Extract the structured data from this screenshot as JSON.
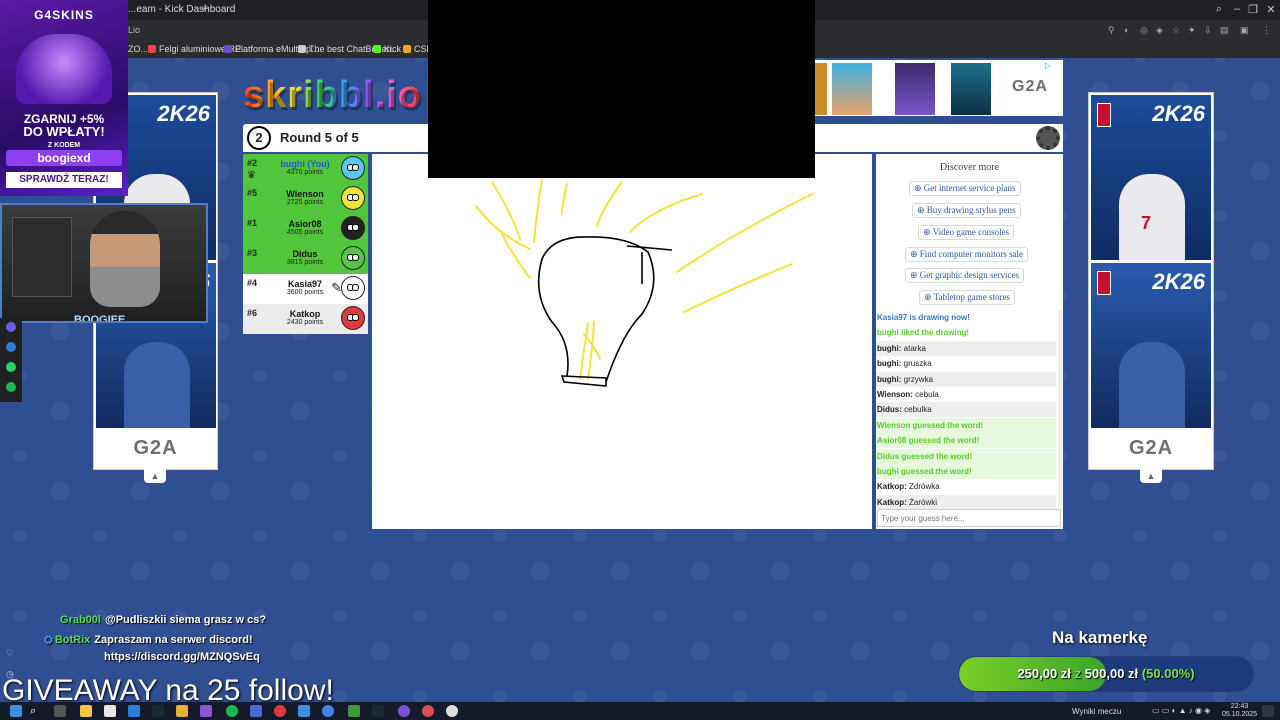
{
  "browser": {
    "tab_title": "...eam - Kick Dashboard",
    "new_tab": "+",
    "address_text": "Lio",
    "window_controls": [
      "–",
      "❐",
      "✕"
    ],
    "bookmarks": [
      {
        "label": "ZO...",
        "color": "#888"
      },
      {
        "label": "Felgi aluminiowe RE...",
        "color": "#e44"
      },
      {
        "label": "Platforma eMultiSp...",
        "color": "#6b4fd6"
      },
      {
        "label": "The best ChatBot an...",
        "color": "#ccc"
      },
      {
        "label": "Kick",
        "color": "#53fc18"
      },
      {
        "label": "CSFlo...",
        "color": "#f5a623"
      }
    ]
  },
  "promo": {
    "logo": "G4SKINS",
    "line1": "ZGARNIJ +5%",
    "line2": "DO WPŁATY!",
    "line3": "Z KODEM",
    "code": "boogiexd",
    "cta": "SPRAWDŹ TERAZ!"
  },
  "webcam": {
    "label": "BOOGIEE"
  },
  "ads": {
    "left_brand": "G2A",
    "right_brand": "G2A",
    "top_brand": "G2A",
    "nba_title": "2K26",
    "jersey_number": "7",
    "caret": "^"
  },
  "game": {
    "logo": "skribbl.io",
    "round_number": "2",
    "round_text": "Round 5 of 5",
    "players": [
      {
        "rank": "#2",
        "name": "bughi (You)",
        "points": "4370 points",
        "bg": "#52c63a",
        "name_color": "#2a56c8",
        "avatar": "#57c8f0",
        "crown": true
      },
      {
        "rank": "#5",
        "name": "Wienson",
        "points": "2725 points",
        "bg": "#52c63a",
        "name_color": "#111",
        "avatar": "#f1e23c"
      },
      {
        "rank": "#1",
        "name": "Asior08",
        "points": "4505 points",
        "bg": "#52c63a",
        "name_color": "#111",
        "avatar": "#222222"
      },
      {
        "rank": "#3",
        "name": "Didus",
        "points": "3815 points",
        "bg": "#52c63a",
        "name_color": "#111",
        "avatar": "#58c24a"
      },
      {
        "rank": "#4",
        "name": "Kasia97",
        "points": "3600 points",
        "bg": "#ffffff",
        "name_color": "#111",
        "avatar": "#ffffff",
        "drawing": true
      },
      {
        "rank": "#6",
        "name": "Katkop",
        "points": "2430 points",
        "bg": "#ececec",
        "name_color": "#111",
        "avatar": "#e23a3a"
      }
    ],
    "discover": {
      "title": "Discover more",
      "links": [
        "Get internet service plans",
        "Buy drawing stylus pens",
        "Video game consoles",
        "Find computer monitors sale",
        "Get graphic design services",
        "Tabletop game stores"
      ]
    },
    "chat": [
      {
        "text": "Kasia97 is drawing now!",
        "style": "blue"
      },
      {
        "text": "bughi liked the drawing!",
        "style": "green"
      },
      {
        "user": "bughi:",
        "text": "atarka",
        "style": "alt"
      },
      {
        "user": "bughi:",
        "text": "gruszka",
        "style": "plain"
      },
      {
        "user": "bughi:",
        "text": "grzywka",
        "style": "alt"
      },
      {
        "user": "Wienson:",
        "text": "cebula",
        "style": "plain"
      },
      {
        "user": "Didus:",
        "text": "cebulka",
        "style": "alt"
      },
      {
        "text": "Wienson guessed the word!",
        "style": "green greenbg"
      },
      {
        "text": "Asior08 guessed the word!",
        "style": "green greenbg"
      },
      {
        "text": "Didus guessed the word!",
        "style": "green greenbg"
      },
      {
        "text": "bughi guessed the word!",
        "style": "green greenbg"
      },
      {
        "user": "Katkop:",
        "text": "Zdrówka",
        "style": "plain"
      },
      {
        "user": "Katkop:",
        "text": "Żarówki",
        "style": "alt"
      }
    ],
    "chat_placeholder": "Type your guess here..."
  },
  "stream": {
    "chat": [
      {
        "user": "Grab00l",
        "text": "@Pudliszkii siema grasz w cs?"
      },
      {
        "user": "BotRix",
        "text": "Zapraszam na serwer discord!"
      },
      {
        "user": "",
        "text": "https://discord.gg/MZNQSvEq"
      }
    ],
    "giveaway": "GIVEAWAY na 25 follow!",
    "goal": {
      "title": "Na kamerkę",
      "current": "250,00 zł",
      "sep": "z",
      "target": "500,00 zł",
      "percent_text": "(50.00%)",
      "progress": 0.5
    }
  },
  "taskbar": {
    "weather": "Wyniki meczu",
    "time": "22:43",
    "date": "05.10.2025"
  }
}
